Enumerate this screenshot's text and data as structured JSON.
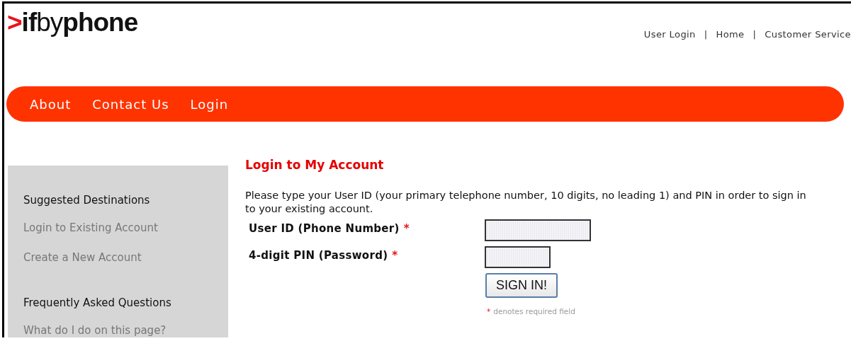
{
  "logo": [
    {
      "text": ">",
      "kind": "mark"
    },
    {
      "text": "if",
      "kind": "bold"
    },
    {
      "text": "by",
      "kind": "light"
    },
    {
      "text": "phone",
      "kind": "bold"
    }
  ],
  "top_links": [
    "User Login",
    "Home",
    "Customer Service"
  ],
  "top_link_separator": "|",
  "nav": [
    "About",
    "Contact Us",
    "Login"
  ],
  "sidebar": [
    {
      "heading": "Suggested Destinations",
      "links": [
        "Login to Existing Account",
        "Create a New Account"
      ]
    },
    {
      "heading": "Frequently Asked Questions",
      "links": [
        "What do I do on this page?"
      ]
    }
  ],
  "title": "Login to My Account",
  "intro": "Please type your User ID (your primary telephone number, 10 digits, no leading 1) and PIN in order to sign in to your existing account.",
  "fields": [
    {
      "label": "User ID (Phone Number)",
      "required_mark": "*",
      "kind": "wide"
    },
    {
      "label": "4-digit PIN (Password)",
      "required_mark": "*",
      "kind": "narrow"
    }
  ],
  "submit": "SIGN IN!",
  "note": {
    "mark": "*",
    "text": "denotes required field"
  }
}
